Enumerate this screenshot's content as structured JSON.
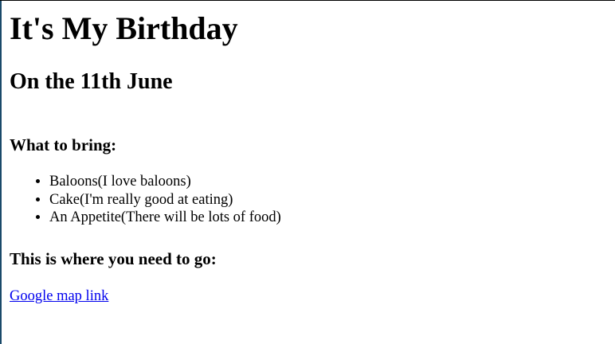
{
  "title": "It's My Birthday",
  "subtitle": "On the 11th June",
  "bring_heading": "What to bring:",
  "bring_items": [
    "Baloons(I love baloons)",
    "Cake(I'm really good at eating)",
    "An Appetite(There will be lots of food)"
  ],
  "location_heading": "This is where you need to go:",
  "map_link": "Google map link"
}
